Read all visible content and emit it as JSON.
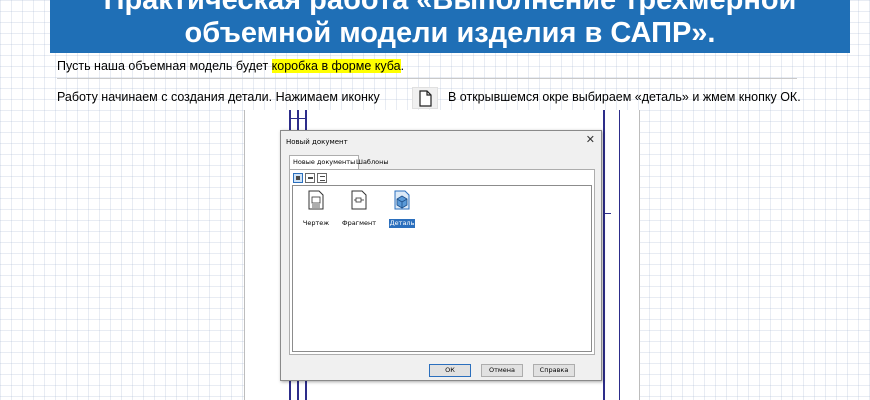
{
  "slide": {
    "title_line1": "Практическая работа «Выполнение трехмерной",
    "title_line2": "объемной модели изделия в САПР».",
    "para1_before": "Пусть наша объемная модель будет ",
    "para1_highlight": "коробка в форме куба",
    "para1_after": ".",
    "para2_part1": "Работу начинаем с создания детали. Нажимаем иконку",
    "para2_part2": "В открывшемся окре выбираем «деталь» и жмем кнопку ОК.",
    "colors": {
      "banner": "#1f6fb6",
      "highlight": "#ffff00",
      "text": "#000000"
    },
    "icon": "new-document-icon"
  },
  "dialog": {
    "title": "Новый документ",
    "close_glyph": "✕",
    "tabs": [
      {
        "label": "Новые документы",
        "active": true
      },
      {
        "label": "Шаблоны",
        "active": false
      }
    ],
    "view_buttons": [
      "large-icons-view-icon",
      "small-icons-view-icon",
      "list-view-icon"
    ],
    "items": [
      {
        "label": "Чертеж",
        "icon": "drawing-document-icon",
        "selected": false
      },
      {
        "label": "Фрагмент",
        "icon": "fragment-document-icon",
        "selected": false
      },
      {
        "label": "Деталь",
        "icon": "part-document-icon",
        "selected": true
      }
    ],
    "buttons": {
      "ok": "ОК",
      "cancel": "Отмена",
      "help": "Справка"
    },
    "colors": {
      "selection": "#2b6fbd",
      "face": "#f0f0f0"
    }
  }
}
